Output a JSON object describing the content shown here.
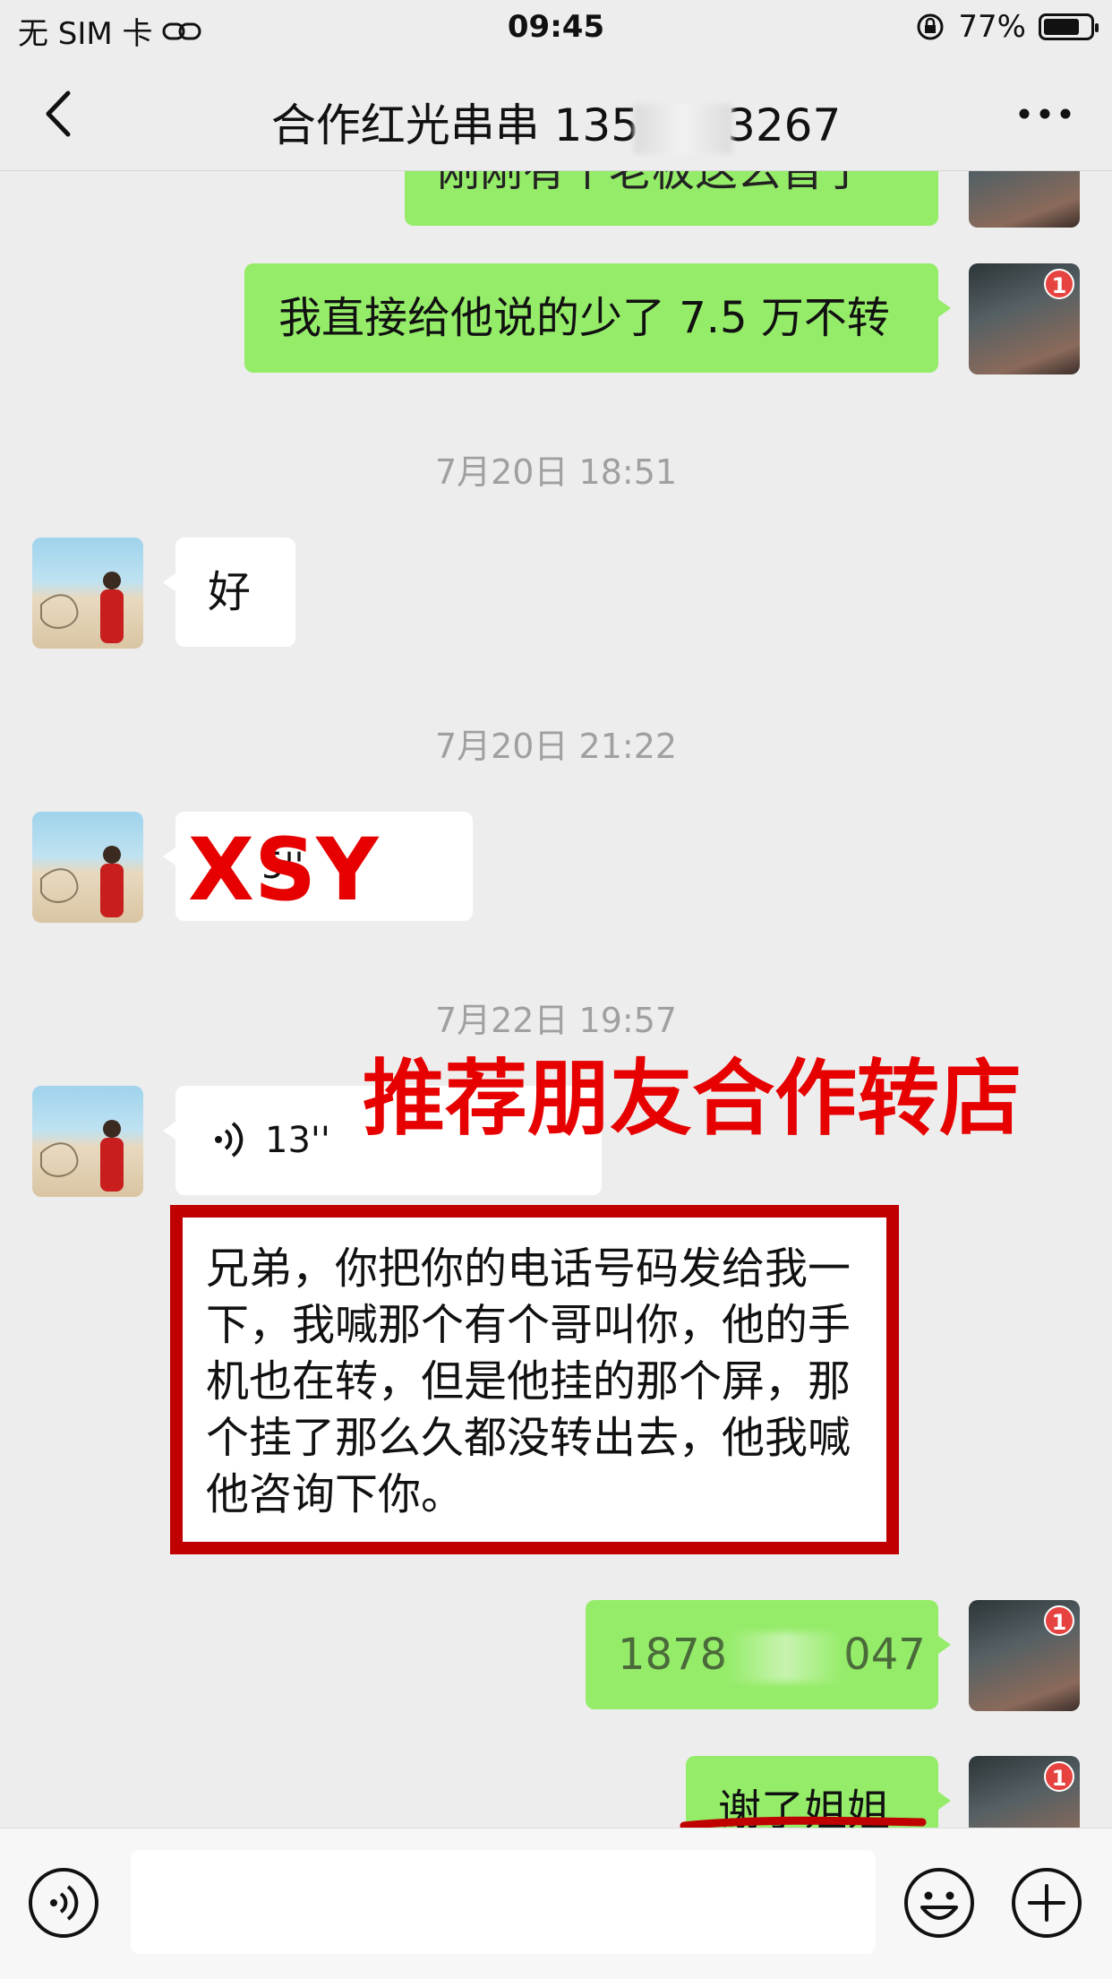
{
  "status_bar": {
    "carrier": "无 SIM 卡",
    "time": "09:45",
    "battery": "77%",
    "battery_level": 0.77
  },
  "header": {
    "title_prefix": "合作红光串串 135",
    "title_suffix": "3267"
  },
  "messages": {
    "m1_text": "刚刚有个老板这么晋了",
    "m2_text": "我直接给他说的少了 7.5 万不转",
    "ts1": "7月20日 18:51",
    "m3_text": "好",
    "ts2": "7月20日 21:22",
    "m4_voice": "5''",
    "ts3": "7月22日 19:57",
    "m5_voice": "13''",
    "m6_prefix": "1878",
    "m6_suffix": "047",
    "m7_text": "谢了姐姐"
  },
  "badges": {
    "count": "1"
  },
  "overlays": {
    "xsy": "XSY",
    "headline": "推荐朋友合作转店",
    "transcript": "兄弟，你把你的电话号码发给我一下，我喊那个有个哥叫你，他的手机也在转，但是他挂的那个屏，那个挂了那么久都没转出去，他我喊他咨询下你。"
  },
  "colors": {
    "background": "#ededed",
    "sent_bubble": "#95ec69",
    "received_bubble": "#ffffff",
    "annotation_red": "#e60000",
    "box_border": "#c00000"
  }
}
